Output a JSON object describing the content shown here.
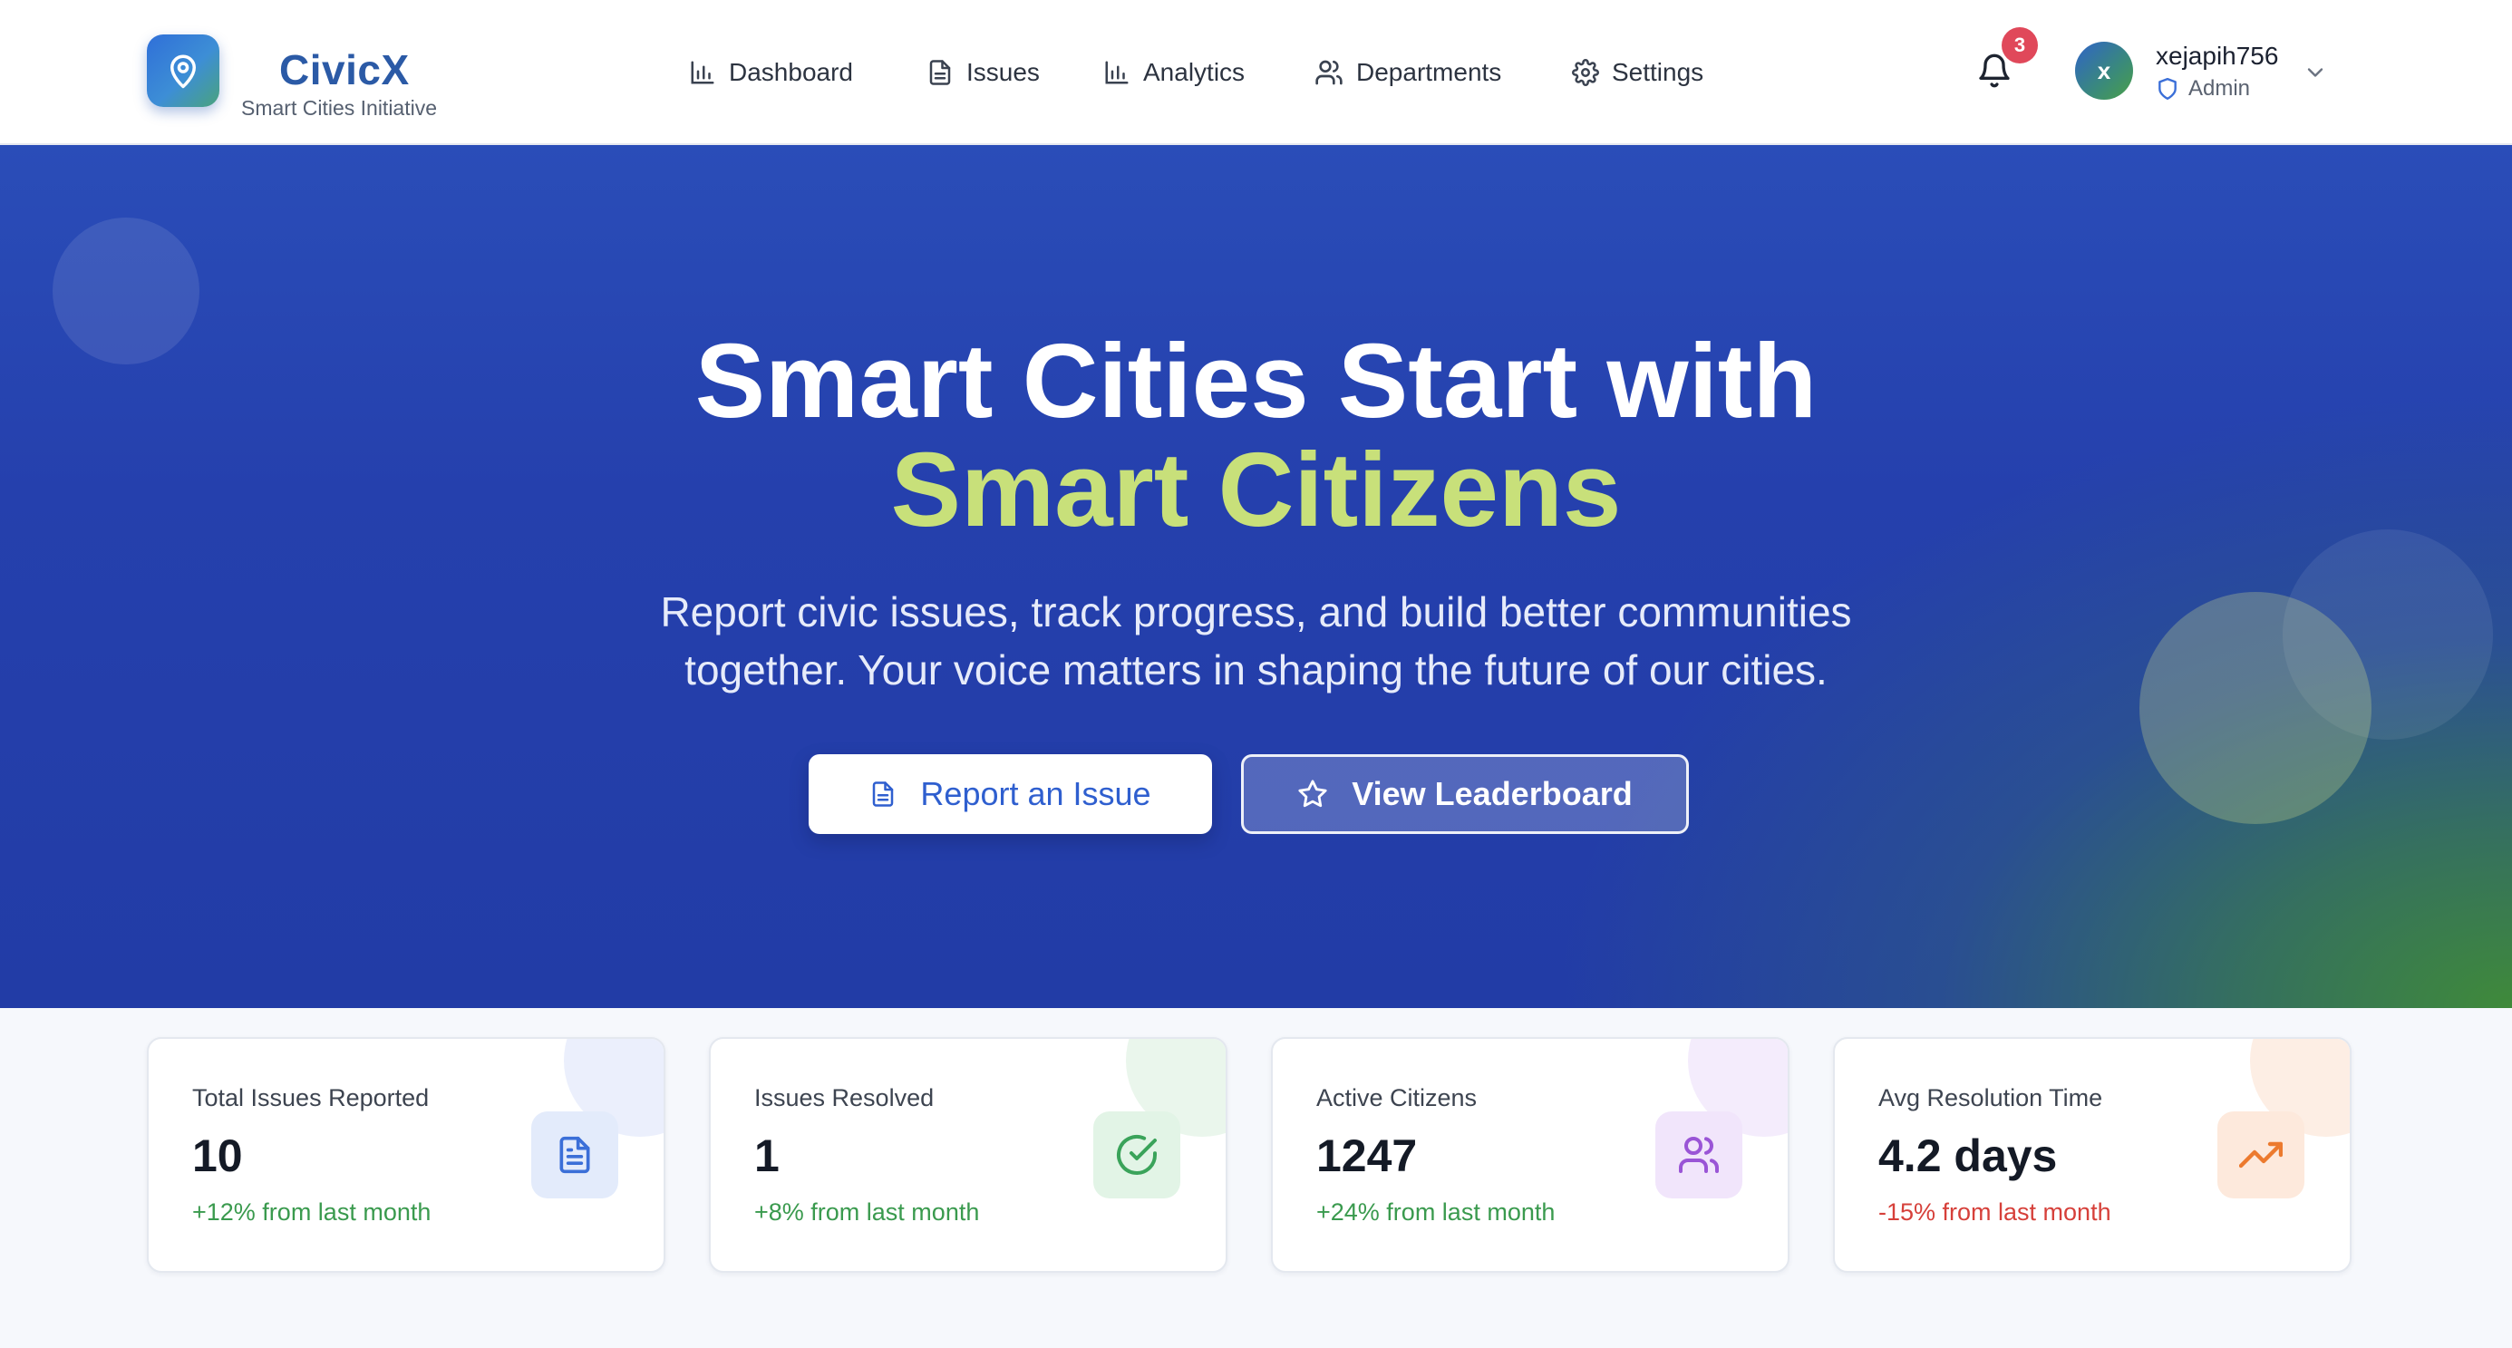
{
  "brand": {
    "name": "CivicX",
    "subtitle": "Smart Cities Initiative"
  },
  "nav": [
    {
      "label": "Dashboard",
      "icon": "bar-chart-icon"
    },
    {
      "label": "Issues",
      "icon": "document-icon"
    },
    {
      "label": "Analytics",
      "icon": "bar-chart-icon"
    },
    {
      "label": "Departments",
      "icon": "users-icon"
    },
    {
      "label": "Settings",
      "icon": "gear-icon"
    }
  ],
  "notifications": {
    "count": "3",
    "icon": "bell-icon"
  },
  "user": {
    "initial": "x",
    "name": "xejapih756",
    "role": "Admin"
  },
  "hero": {
    "title_line1": "Smart Cities Start with",
    "title_line2": "Smart Citizens",
    "subtitle_line1": "Report civic issues, track progress, and build better communities",
    "subtitle_line2": "together. Your voice matters in shaping the future of our cities.",
    "primary_button": "Report an Issue",
    "secondary_button": "View Leaderboard"
  },
  "stats": [
    {
      "label": "Total Issues Reported",
      "value": "10",
      "change": "+12% from last month",
      "change_color": "#3a9a4e",
      "icon": "document-icon",
      "icon_color": "#3b6fd8",
      "icon_bg": "#e3ebfb",
      "bubble_bg": "#ebeffc"
    },
    {
      "label": "Issues Resolved",
      "value": "1",
      "change": "+8% from last month",
      "change_color": "#3a9a4e",
      "icon": "check-circle-icon",
      "icon_color": "#3aa35a",
      "icon_bg": "#e2f4e6",
      "bubble_bg": "#eaf6ec"
    },
    {
      "label": "Active Citizens",
      "value": "1247",
      "change": "+24% from last month",
      "change_color": "#3a9a4e",
      "icon": "users-icon",
      "icon_color": "#9a55d6",
      "icon_bg": "#f1e5fb",
      "bubble_bg": "#f4ecfc"
    },
    {
      "label": "Avg Resolution Time",
      "value": "4.2 days",
      "change": "-15% from last month",
      "change_color": "#d6403a",
      "icon": "trending-up-icon",
      "icon_color": "#ec7a2e",
      "icon_bg": "#fde9dc",
      "bubble_bg": "#fdeee4"
    }
  ]
}
